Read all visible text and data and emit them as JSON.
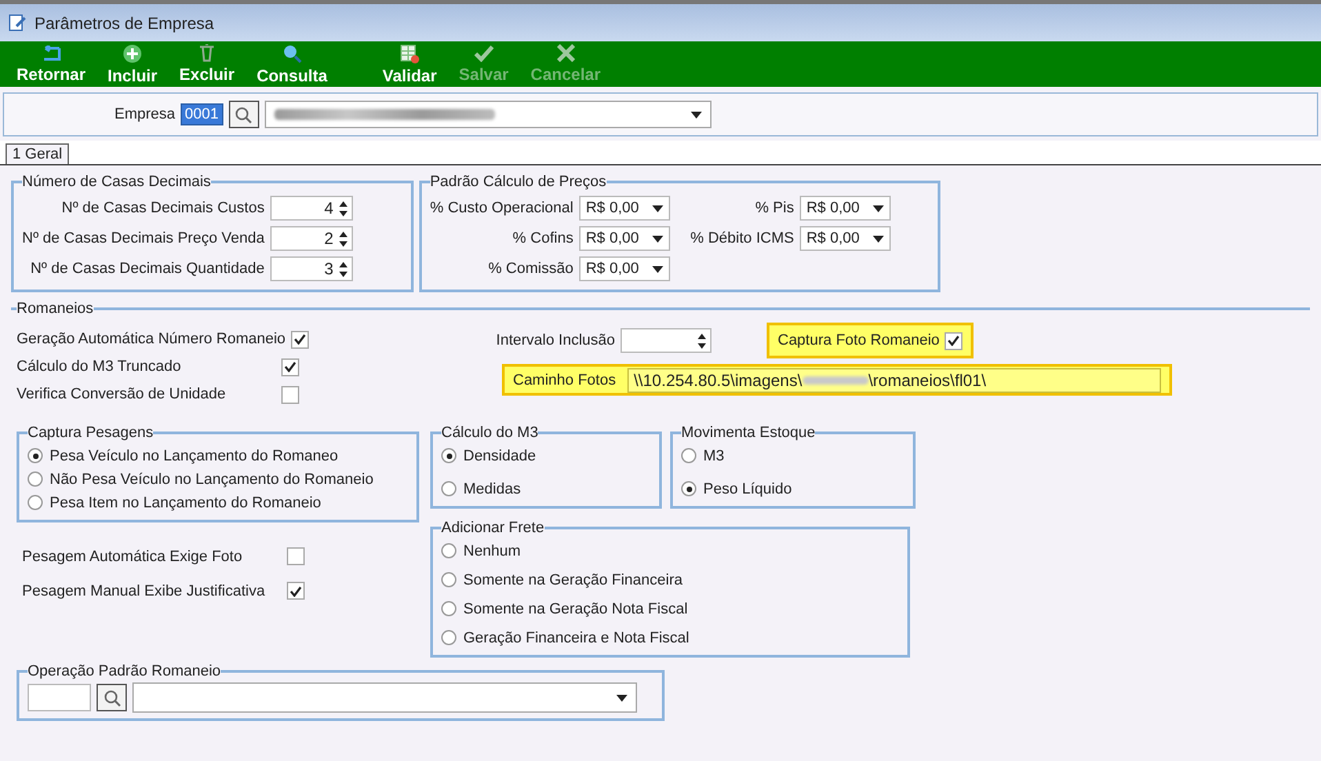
{
  "window": {
    "title": "Parâmetros de Empresa"
  },
  "toolbar": [
    {
      "label": "Retornar",
      "kind": "back",
      "disabled": false
    },
    {
      "label": "Incluir",
      "kind": "add",
      "disabled": false
    },
    {
      "label": "Excluir",
      "kind": "delete",
      "disabled": false
    },
    {
      "label": "Consulta",
      "kind": "search",
      "disabled": false
    },
    {
      "label": "Validar",
      "kind": "validate",
      "disabled": false
    },
    {
      "label": "Salvar",
      "kind": "save",
      "disabled": true
    },
    {
      "label": "Cancelar",
      "kind": "cancel",
      "disabled": true
    }
  ],
  "empresa": {
    "label": "Empresa",
    "code": "0001"
  },
  "tabs": [
    {
      "label": "1 Geral",
      "selected": true
    }
  ],
  "casas_decimais": {
    "title": "Número de Casas Decimais",
    "fields": [
      {
        "label": "Nº de Casas Decimais Custos",
        "value": "4"
      },
      {
        "label": "Nº de Casas Decimais Preço Venda",
        "value": "2"
      },
      {
        "label": "Nº de Casas Decimais Quantidade",
        "value": "3"
      }
    ]
  },
  "precos": {
    "title": "Padrão Cálculo de Preços",
    "left": [
      {
        "label": "% Custo Operacional",
        "value": "R$ 0,00"
      },
      {
        "label": "% Cofins",
        "value": "R$ 0,00"
      },
      {
        "label": "% Comissão",
        "value": "R$ 0,00"
      }
    ],
    "right": [
      {
        "label": "% Pis",
        "value": "R$ 0,00"
      },
      {
        "label": "% Débito ICMS",
        "value": "R$ 0,00"
      }
    ]
  },
  "romaneios": {
    "title": "Romaneios",
    "checks": [
      {
        "label": "Geração Automática Número Romaneio",
        "checked": true
      },
      {
        "label": "Cálculo do M3 Truncado",
        "checked": true
      },
      {
        "label": "Verifica Conversão de Unidade",
        "checked": false
      }
    ],
    "intervalo": {
      "label": "Intervalo Inclusão"
    },
    "captura_foto": {
      "label": "Captura Foto Romaneio",
      "checked": true
    },
    "caminho": {
      "label": "Caminho Fotos",
      "value_start": "\\\\10.254.80.5\\imagens\\",
      "value_end": "\\romaneios\\fl01\\"
    },
    "captura_pesagens": {
      "title": "Captura Pesagens",
      "options": [
        {
          "label": "Pesa Veículo no Lançamento do Romaneo",
          "selected": true
        },
        {
          "label": "Não Pesa Veículo no Lançamento do Romaneio",
          "selected": false
        },
        {
          "label": "Pesa Item no Lançamento do Romaneio",
          "selected": false
        }
      ]
    },
    "calculo_m3": {
      "title": "Cálculo do M3",
      "options": [
        {
          "label": "Densidade",
          "selected": true
        },
        {
          "label": "Medidas",
          "selected": false
        }
      ]
    },
    "movimenta_estoque": {
      "title": "Movimenta Estoque",
      "options": [
        {
          "label": "M3",
          "selected": false
        },
        {
          "label": "Peso Líquido",
          "selected": true
        }
      ]
    },
    "pesagem_checks": [
      {
        "label": "Pesagem Automática Exige Foto",
        "checked": false
      },
      {
        "label": "Pesagem Manual Exibe Justificativa",
        "checked": true
      }
    ],
    "adicionar_frete": {
      "title": "Adicionar Frete",
      "options": [
        {
          "label": "Nenhum",
          "selected": false
        },
        {
          "label": "Somente na Geração Financeira",
          "selected": false
        },
        {
          "label": "Somente na Geração Nota Fiscal",
          "selected": false
        },
        {
          "label": "Geração Financeira e Nota Fiscal",
          "selected": false
        }
      ]
    },
    "operacao": {
      "title": "Operação Padrão Romaneio"
    }
  }
}
